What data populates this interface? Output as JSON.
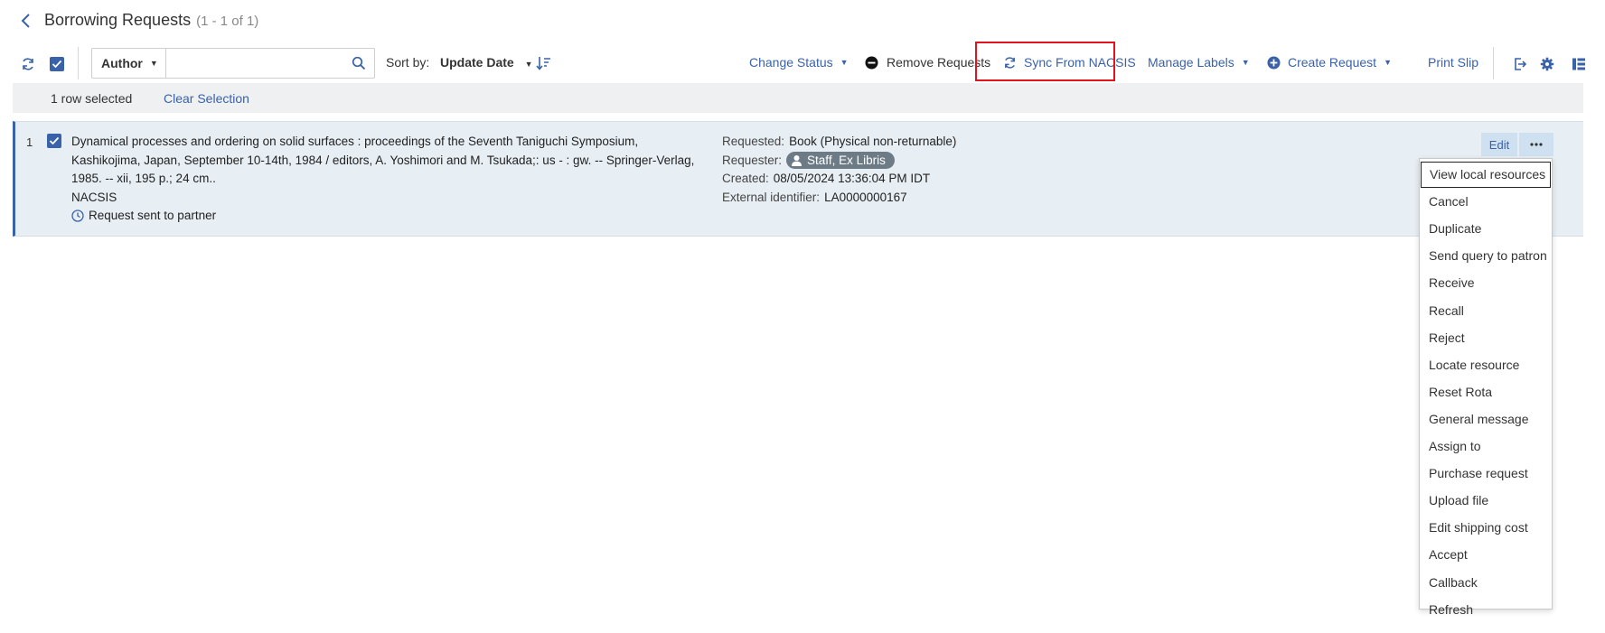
{
  "header": {
    "title": "Borrowing Requests",
    "count": "(1 - 1 of 1)"
  },
  "toolbar": {
    "search": {
      "field": "Author",
      "value": "",
      "placeholder": ""
    },
    "sort": {
      "label": "Sort by:",
      "value": "Update Date"
    },
    "actions": {
      "change_status": "Change Status",
      "remove_requests": "Remove Requests",
      "sync_from_nacsis": "Sync From NACSIS",
      "manage_labels": "Manage Labels",
      "create_request": "Create Request",
      "print_slip": "Print Slip"
    }
  },
  "selection": {
    "count_text": "1 row selected",
    "clear_label": "Clear Selection"
  },
  "row": {
    "index": "1",
    "title": "Dynamical processes and ordering on solid surfaces : proceedings of the Seventh Taniguchi Symposium, Kashikojima, Japan, September 10-14th, 1984 / editors, A. Yoshimori and M. Tsukada;: us - : gw. -- Springer-Verlag, 1985. -- xii, 195 p.; 24 cm..",
    "source": "NACSIS",
    "status": "Request sent to partner",
    "requested_label": "Requested:",
    "requested_value": "Book (Physical non-returnable)",
    "requester_label": "Requester:",
    "requester_value": "Staff, Ex Libris",
    "created_label": "Created:",
    "created_value": "08/05/2024 13:36:04 PM IDT",
    "external_id_label": "External identifier:",
    "external_id_value": "LA0000000167",
    "edit_label": "Edit"
  },
  "row_menu": {
    "items": [
      "View local resources",
      "Cancel",
      "Duplicate",
      "Send query to patron",
      "Receive",
      "Recall",
      "Reject",
      "Locate resource",
      "Reset Rota",
      "General message",
      "Assign to",
      "Purchase request",
      "Upload file",
      "Edit shipping cost",
      "Accept",
      "Callback",
      "Refresh"
    ]
  },
  "colors": {
    "accent": "#3a62a8",
    "highlight": "#e0131f",
    "row_bg": "#e7eff5",
    "chip_bg": "#6d7b86"
  }
}
